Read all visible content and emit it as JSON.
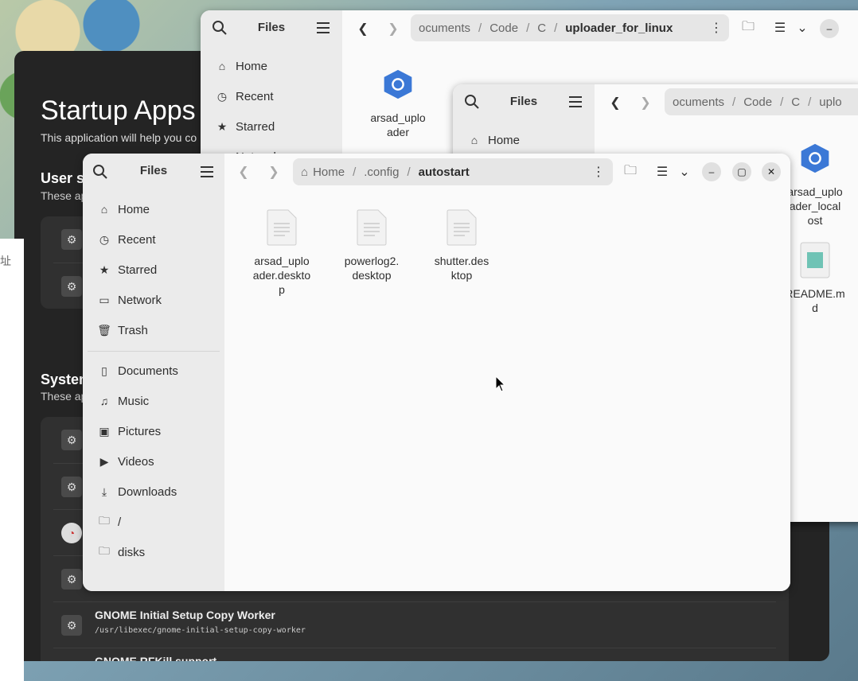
{
  "startup": {
    "title": "Startup Apps",
    "subtitle": "This application will help you co",
    "user_title": "User s",
    "user_sub": "These ap",
    "system_title": "System",
    "system_sub": "These ap",
    "rows": [
      {
        "name": "GNOME Initial Setup Copy Worker",
        "cmd": "/usr/libexec/gnome-initial-setup-copy-worker"
      },
      {
        "name": "GNOME RFKill support",
        "cmd": ""
      }
    ]
  },
  "bg_strip": {
    "zh": "址"
  },
  "win_back": {
    "title": "Files",
    "nav": [
      "Home",
      "Recent",
      "Starred",
      "Network"
    ],
    "path": [
      "ocuments",
      "Code",
      "C"
    ],
    "path_current": "uploader_for_linux",
    "files": [
      {
        "name": "arsad_uplo\nader"
      }
    ]
  },
  "win_mid": {
    "title": "Files",
    "nav": [
      "Home"
    ],
    "path": [
      "ocuments",
      "Code",
      "C",
      "uplo"
    ],
    "files": [
      {
        "name": "arsad_uplo\nader_local\nost"
      },
      {
        "name": "README.m\nd"
      }
    ]
  },
  "win_front": {
    "title": "Files",
    "nav_top": [
      "Home",
      "Recent",
      "Starred",
      "Network",
      "Trash"
    ],
    "nav_bottom": [
      "Documents",
      "Music",
      "Pictures",
      "Videos",
      "Downloads",
      "/",
      "disks"
    ],
    "path": [
      "Home",
      ".config"
    ],
    "path_current": "autostart",
    "files": [
      {
        "name": "arsad_uplo\nader.deskto\np"
      },
      {
        "name": "powerlog2.\ndesktop"
      },
      {
        "name": "shutter.des\nktop"
      }
    ]
  }
}
